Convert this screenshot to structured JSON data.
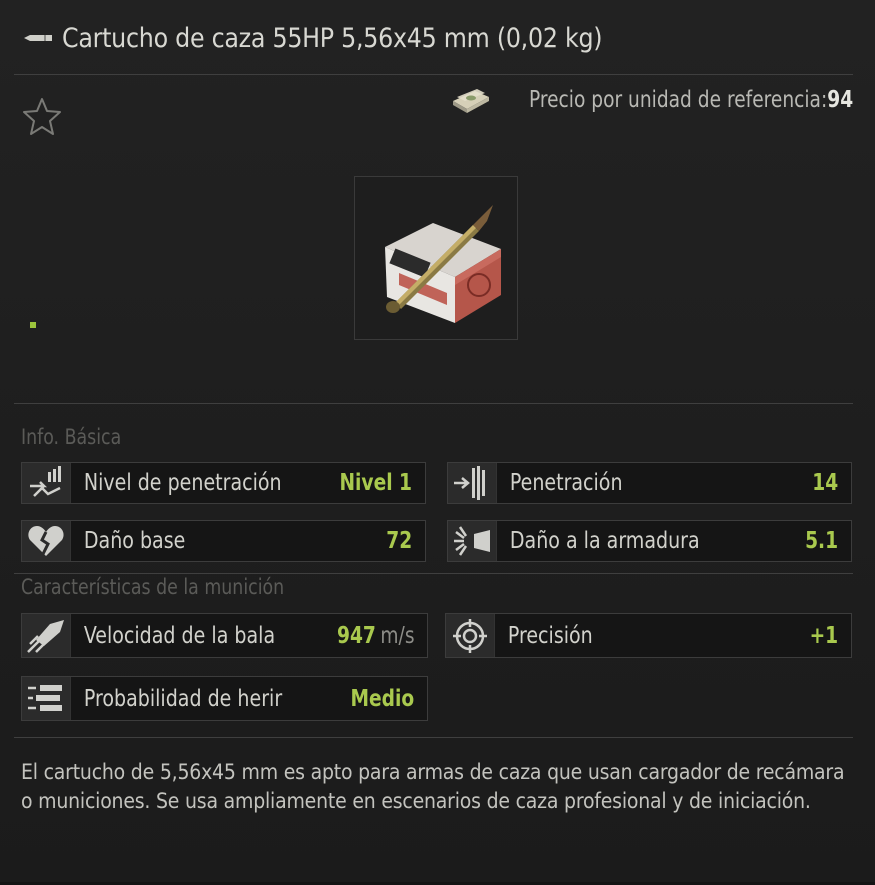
{
  "item": {
    "title": "Cartucho de caza 55HP 5,56x45 mm (0,02 kg)",
    "price_label": "Precio por unidad de referencia:",
    "price_value": "94"
  },
  "sections": {
    "basic": "Info. Básica",
    "ammo": "Características de la munición"
  },
  "stats": {
    "penetration_level": {
      "label": "Nivel de penetración",
      "value": "Nivel 1",
      "icon": "penetration-level-icon"
    },
    "penetration": {
      "label": "Penetración",
      "value": "14",
      "icon": "penetration-icon"
    },
    "base_damage": {
      "label": "Daño base",
      "value": "72",
      "icon": "broken-heart-icon"
    },
    "armor_damage": {
      "label": "Daño a la armadura",
      "value": "5.1",
      "icon": "armor-damage-icon"
    },
    "bullet_velocity": {
      "label": "Velocidad de la bala",
      "value": "947",
      "unit": "m/s",
      "icon": "bullet-velocity-icon"
    },
    "accuracy": {
      "label": "Precisión",
      "value": "+1",
      "icon": "crosshair-icon"
    },
    "injury_chance": {
      "label": "Probabilidad de herir",
      "value": "Medio",
      "icon": "injury-chance-icon"
    }
  },
  "description": "El cartucho de 5,56x45 mm es apto para armas de caza que usan cargador de recámara o municiones. Se usa ampliamente en escenarios de caza profesional y de iniciación.",
  "colors": {
    "accent_green": "#a9c94e",
    "panel_bg": "#1f1f1f",
    "stat_bg": "#151515"
  }
}
